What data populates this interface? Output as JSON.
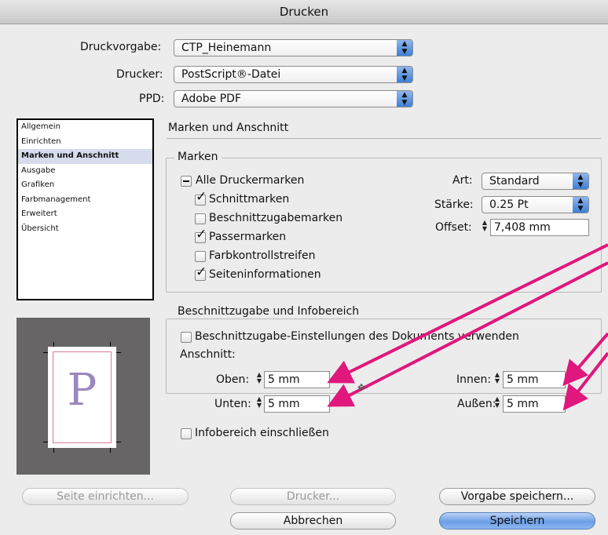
{
  "window": {
    "title": "Drucken"
  },
  "top": {
    "druckvorgabe": {
      "label": "Druckvorgabe:",
      "value": "CTP_Heinemann"
    },
    "drucker": {
      "label": "Drucker:",
      "value": "PostScript®-Datei"
    },
    "ppd": {
      "label": "PPD:",
      "value": "Adobe PDF"
    }
  },
  "sidebar": {
    "items": [
      {
        "label": "Allgemein",
        "selected": false
      },
      {
        "label": "Einrichten",
        "selected": false
      },
      {
        "label": "Marken und Anschnitt",
        "selected": true
      },
      {
        "label": "Ausgabe",
        "selected": false
      },
      {
        "label": "Grafiken",
        "selected": false
      },
      {
        "label": "Farbmanagement",
        "selected": false
      },
      {
        "label": "Erweitert",
        "selected": false
      },
      {
        "label": "Übersicht",
        "selected": false
      }
    ]
  },
  "section": {
    "title": "Marken und Anschnitt"
  },
  "marken": {
    "legend": "Marken",
    "all": {
      "label": "Alle Druckermarken",
      "state": "mixed"
    },
    "options": [
      {
        "label": "Schnittmarken",
        "checked": true
      },
      {
        "label": "Beschnittzugabemarken",
        "checked": false
      },
      {
        "label": "Passermarken",
        "checked": true
      },
      {
        "label": "Farbkontrollstreifen",
        "checked": false
      },
      {
        "label": "Seiteninformationen",
        "checked": true
      }
    ],
    "art": {
      "label": "Art:",
      "value": "Standard"
    },
    "staerke": {
      "label": "Stärke:",
      "value": "0.25 Pt"
    },
    "offset": {
      "label": "Offset:",
      "value": "7,408 mm"
    }
  },
  "bleed": {
    "legend": "Beschnittzugabe und Infobereich",
    "use_doc": {
      "label": "Beschnittzugabe-Einstellungen des Dokuments verwenden",
      "checked": false
    },
    "anschnitt_label": "Anschnitt:",
    "oben": {
      "label": "Oben:",
      "value": "5 mm"
    },
    "unten": {
      "label": "Unten:",
      "value": "5 mm"
    },
    "innen": {
      "label": "Innen:",
      "value": "5 mm"
    },
    "aussen": {
      "label": "Außen:",
      "value": "5 mm"
    },
    "infobereich": {
      "label": "Infobereich einschließen",
      "checked": false
    }
  },
  "preview": {
    "letter": "P"
  },
  "buttons": {
    "seite_einrichten": "Seite einrichten...",
    "drucker": "Drucker...",
    "vorgabe_speichern": "Vorgabe speichern...",
    "abbrechen": "Abbrechen",
    "speichern": "Speichern"
  },
  "colors": {
    "annotation_arrows": "#e0177d",
    "default_button": "#6c9ee6"
  }
}
